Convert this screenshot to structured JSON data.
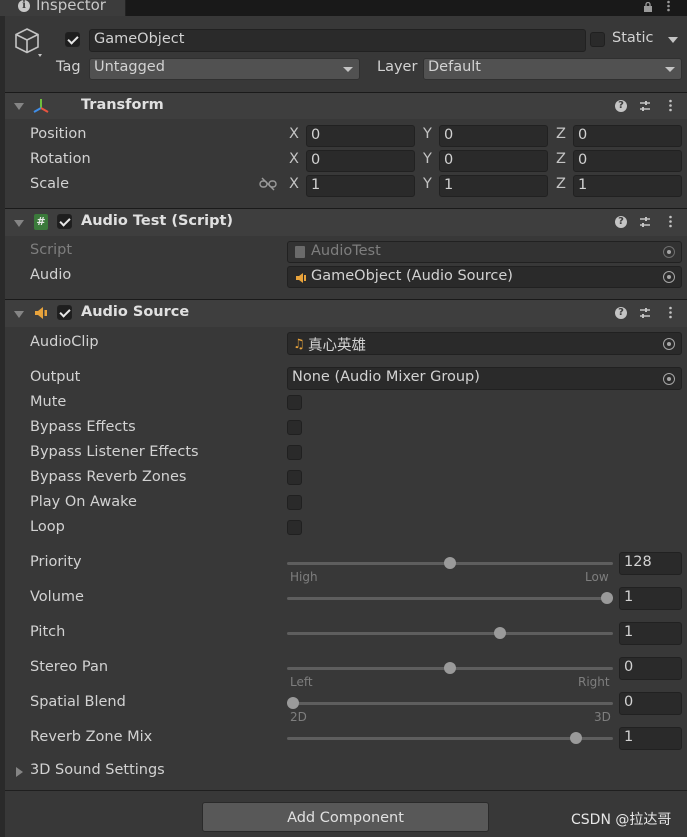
{
  "tab": {
    "title": "Inspector"
  },
  "gameobject": {
    "active": true,
    "name": "GameObject",
    "static_label": "Static",
    "static_checked": false,
    "tag_label": "Tag",
    "tag_value": "Untagged",
    "layer_label": "Layer",
    "layer_value": "Default"
  },
  "transform": {
    "title": "Transform",
    "rows": [
      {
        "label": "Position",
        "x": "0",
        "y": "0",
        "z": "0"
      },
      {
        "label": "Rotation",
        "x": "0",
        "y": "0",
        "z": "0"
      },
      {
        "label": "Scale",
        "x": "1",
        "y": "1",
        "z": "1"
      }
    ],
    "axis_labels": [
      "X",
      "Y",
      "Z"
    ]
  },
  "audio_test": {
    "title": "Audio Test (Script)",
    "enabled": true,
    "script_label": "Script",
    "script_value": "AudioTest",
    "audio_label": "Audio",
    "audio_value": "GameObject (Audio Source)"
  },
  "audio_source": {
    "title": "Audio Source",
    "enabled": true,
    "clip_label": "AudioClip",
    "clip_value": "真心英雄",
    "output_label": "Output",
    "output_value": "None (Audio Mixer Group)",
    "toggles": [
      {
        "label": "Mute",
        "checked": false
      },
      {
        "label": "Bypass Effects",
        "checked": false
      },
      {
        "label": "Bypass Listener Effects",
        "checked": false
      },
      {
        "label": "Bypass Reverb Zones",
        "checked": false
      },
      {
        "label": "Play On Awake",
        "checked": false
      },
      {
        "label": "Loop",
        "checked": false
      }
    ],
    "sliders": [
      {
        "label": "Priority",
        "value": "128",
        "fraction": 0.5,
        "min_label": "High",
        "max_label": "Low"
      },
      {
        "label": "Volume",
        "value": "1",
        "fraction": 1.0,
        "min_label": "",
        "max_label": ""
      },
      {
        "label": "Pitch",
        "value": "1",
        "fraction": 0.66,
        "min_label": "",
        "max_label": ""
      },
      {
        "label": "Stereo Pan",
        "value": "0",
        "fraction": 0.5,
        "min_label": "Left",
        "max_label": "Right"
      },
      {
        "label": "Spatial Blend",
        "value": "0",
        "fraction": 0.0,
        "min_label": "2D",
        "max_label": "3D"
      },
      {
        "label": "Reverb Zone Mix",
        "value": "1",
        "fraction": 0.9,
        "min_label": "",
        "max_label": ""
      }
    ],
    "sound_settings_label": "3D Sound Settings"
  },
  "add_component_label": "Add Component",
  "watermark": "CSDN @拉达哥",
  "colors": {
    "background": "#383838",
    "header": "#3e3e3e",
    "field": "#2a2a2a",
    "script_icon": "#3b7a3b",
    "audio_icon": "#e8a33c"
  }
}
